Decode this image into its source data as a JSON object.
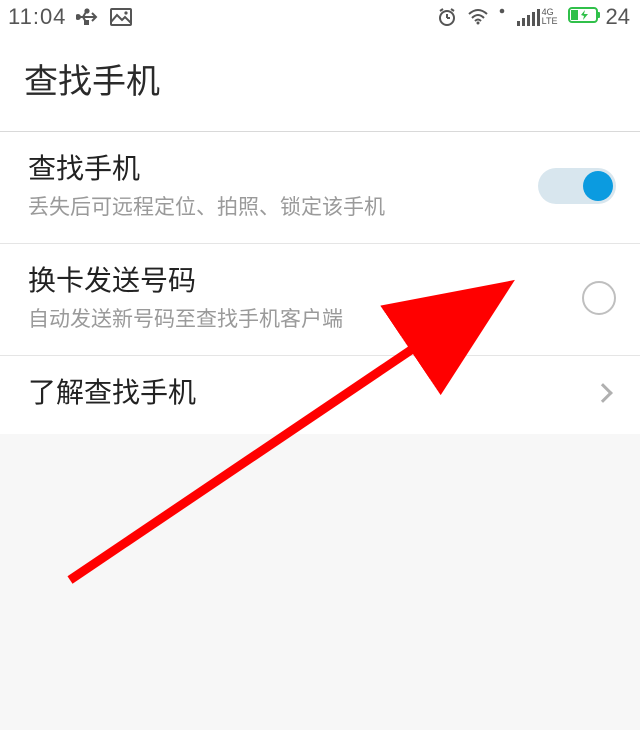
{
  "status": {
    "time": "11:04",
    "battery_text": "24"
  },
  "header": {
    "title": "查找手机"
  },
  "items": {
    "find_phone": {
      "title": "查找手机",
      "sub": "丢失后可远程定位、拍照、锁定该手机"
    },
    "sim_send": {
      "title": "换卡发送号码",
      "sub": "自动发送新号码至查找手机客户端"
    },
    "about": {
      "title": "了解查找手机"
    }
  }
}
